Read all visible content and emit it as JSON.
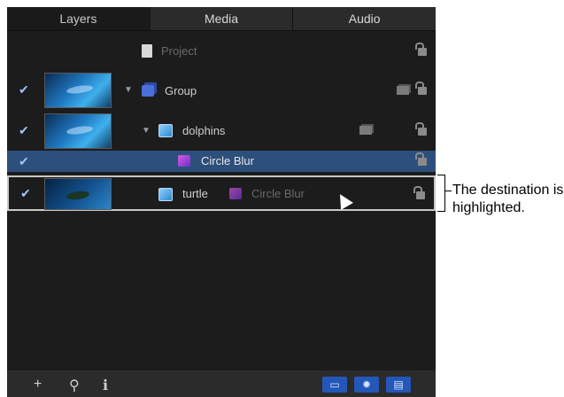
{
  "tabs": [
    {
      "label": "Layers",
      "active": true
    },
    {
      "label": "Media",
      "active": false
    },
    {
      "label": "Audio",
      "active": false
    }
  ],
  "layers": {
    "project": {
      "label": "Project"
    },
    "group": {
      "label": "Group",
      "checked": true
    },
    "dolphins": {
      "label": "dolphins",
      "checked": true
    },
    "circle_blur": {
      "label": "Circle Blur",
      "checked": true,
      "selected": true
    },
    "turtle": {
      "label": "turtle",
      "checked": true,
      "filter_label": "Circle Blur",
      "highlighted": true
    }
  },
  "footer": {
    "add_label": "+",
    "search_label": "⚲",
    "info_label": "ℹ"
  },
  "callout": {
    "text": "The destination is highlighted."
  },
  "colors": {
    "panel_bg": "#1c1c1c",
    "selection": "#2c4f7c",
    "accent_blue": "#2457b8"
  }
}
